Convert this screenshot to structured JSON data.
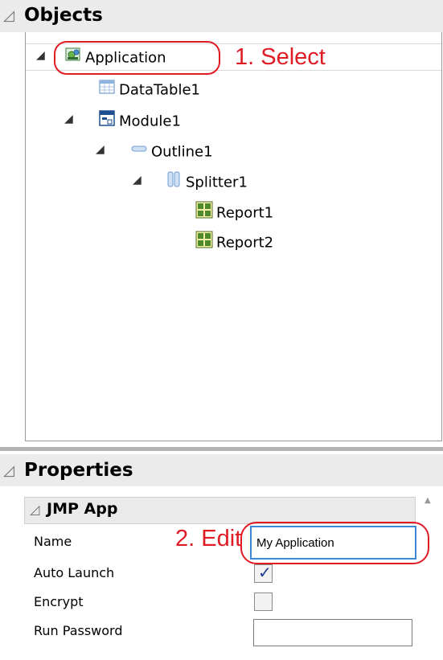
{
  "objects_panel": {
    "title": "Objects",
    "tree": [
      {
        "label": "Application",
        "icon": "application-icon"
      },
      {
        "label": "DataTable1",
        "icon": "datatable-icon"
      },
      {
        "label": "Module1",
        "icon": "module-icon"
      },
      {
        "label": "Outline1",
        "icon": "outline-icon"
      },
      {
        "label": "Splitter1",
        "icon": "splitter-icon"
      },
      {
        "label": "Report1",
        "icon": "report-icon"
      },
      {
        "label": "Report2",
        "icon": "report-icon"
      }
    ]
  },
  "properties_panel": {
    "title": "Properties",
    "group": "JMP App",
    "fields": {
      "name_label": "Name",
      "name_value": "My Application",
      "auto_launch_label": "Auto Launch",
      "auto_launch_checked": true,
      "encrypt_label": "Encrypt",
      "encrypt_checked": false,
      "run_password_label": "Run Password",
      "run_password_value": ""
    }
  },
  "annotations": {
    "select": "1. Select",
    "edit": "2. Edit",
    "color": "#e01b24"
  }
}
